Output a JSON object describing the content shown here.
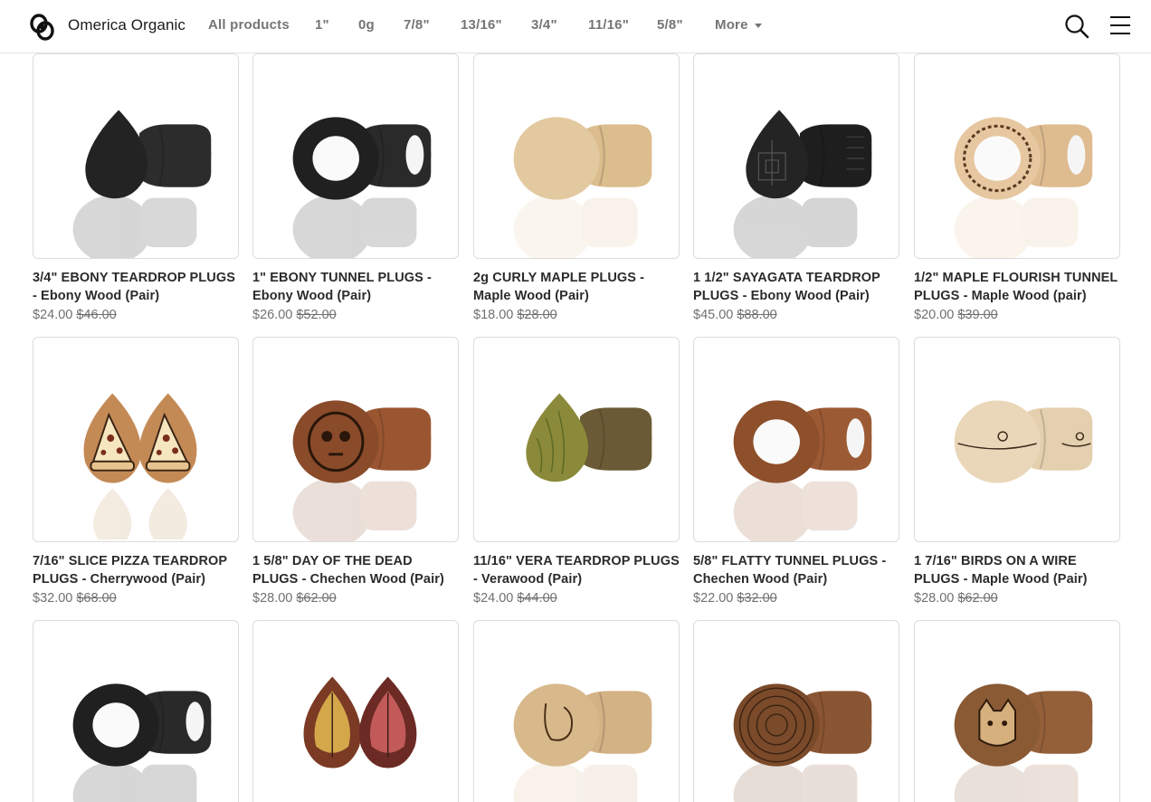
{
  "header": {
    "store_name": "Omerica Organic",
    "nav": [
      {
        "label": "All products"
      },
      {
        "label": "1\""
      },
      {
        "label": "0g"
      },
      {
        "label": "7/8\""
      },
      {
        "label": "13/16\""
      },
      {
        "label": "3/4\""
      },
      {
        "label": "11/16\""
      },
      {
        "label": "5/8\""
      }
    ],
    "more_label": "More",
    "icons": {
      "search": "search-icon",
      "menu": "hamburger-menu-icon",
      "logo": "omerica-logo"
    }
  },
  "products": [
    {
      "title": "3/4\" EBONY TEARDROP PLUGS - Ebony Wood (Pair)",
      "price": "$24.00",
      "compare_price": "$46.00",
      "image": "ebony-teardrop"
    },
    {
      "title": "1\" EBONY TUNNEL PLUGS - Ebony Wood (Pair)",
      "price": "$26.00",
      "compare_price": "$52.00",
      "image": "ebony-tunnel"
    },
    {
      "title": "2g CURLY MAPLE PLUGS - Maple Wood (Pair)",
      "price": "$18.00",
      "compare_price": "$28.00",
      "image": "maple-plug"
    },
    {
      "title": "1 1/2\" SAYAGATA TEARDROP PLUGS - Ebony Wood (Pair)",
      "price": "$45.00",
      "compare_price": "$88.00",
      "image": "sayagata-teardrop"
    },
    {
      "title": "1/2\" MAPLE FLOURISH TUNNEL PLUGS - Maple Wood (pair)",
      "price": "$20.00",
      "compare_price": "$39.00",
      "image": "maple-flourish-tunnel"
    },
    {
      "title": "7/16\" SLICE PIZZA TEARDROP PLUGS - Cherrywood (Pair)",
      "price": "$32.00",
      "compare_price": "$68.00",
      "image": "pizza-teardrop"
    },
    {
      "title": "1 5/8\" DAY OF THE DEAD PLUGS - Chechen Wood (Pair)",
      "price": "$28.00",
      "compare_price": "$62.00",
      "image": "day-of-dead-plug"
    },
    {
      "title": "11/16\" VERA TEARDROP PLUGS - Verawood (Pair)",
      "price": "$24.00",
      "compare_price": "$44.00",
      "image": "vera-teardrop"
    },
    {
      "title": "5/8\" FLATTY TUNNEL PLUGS - Chechen Wood (Pair)",
      "price": "$22.00",
      "compare_price": "$32.00",
      "image": "flatty-tunnel"
    },
    {
      "title": "1 7/16\" BIRDS ON A WIRE PLUGS - Maple Wood (Pair)",
      "price": "$28.00",
      "compare_price": "$62.00",
      "image": "birds-on-wire"
    },
    {
      "title": "",
      "price": "",
      "compare_price": "",
      "image": "ebony-tunnel-2"
    },
    {
      "title": "",
      "price": "",
      "compare_price": "",
      "image": "leaf-teardrop"
    },
    {
      "title": "",
      "price": "",
      "compare_price": "",
      "image": "bunny-plug"
    },
    {
      "title": "",
      "price": "",
      "compare_price": "",
      "image": "wood-ring-plug"
    },
    {
      "title": "",
      "price": "",
      "compare_price": "",
      "image": "cat-plug"
    }
  ]
}
